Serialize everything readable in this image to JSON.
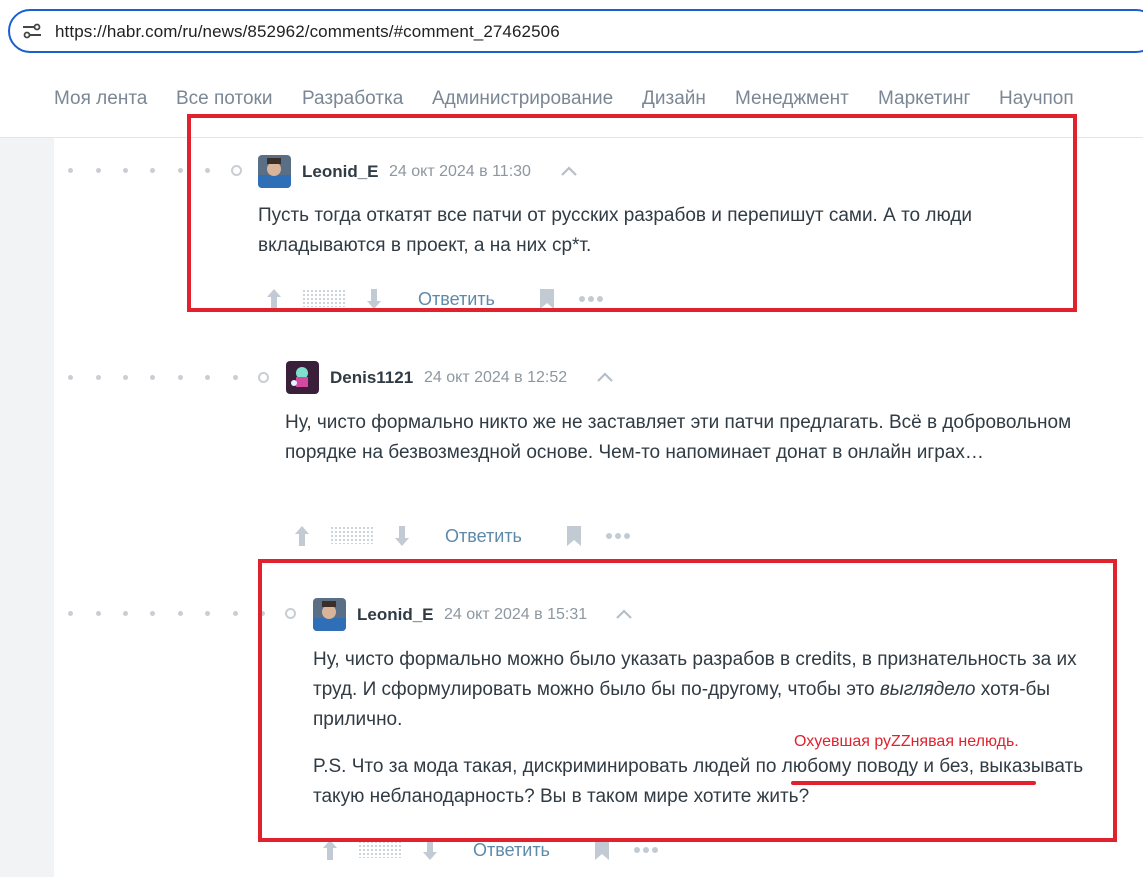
{
  "browser": {
    "url": "https://habr.com/ru/news/852962/comments/#comment_27462506"
  },
  "nav": {
    "items": [
      {
        "label": "Моя лента"
      },
      {
        "label": "Все потоки"
      },
      {
        "label": "Разработка"
      },
      {
        "label": "Администрирование"
      },
      {
        "label": "Дизайн"
      },
      {
        "label": "Менеджмент"
      },
      {
        "label": "Маркетинг"
      },
      {
        "label": "Научпоп"
      }
    ]
  },
  "comments": [
    {
      "username": "Leonid_E",
      "timestamp": "24 окт 2024 в 11:30",
      "text": "Пусть тогда откатят все патчи от русских разрабов и перепишут сами. А то люди вкладываются в проект, а на них ср*т.",
      "reply_label": "Ответить"
    },
    {
      "username": "Denis1121",
      "timestamp": "24 окт 2024 в 12:52",
      "text": "Ну, чисто формально никто же не заставляет эти патчи предлагать. Всё в добровольном порядке на безвозмездной основе. Чем-то напоминает донат в онлайн играх…",
      "reply_label": "Ответить"
    },
    {
      "username": "Leonid_E",
      "timestamp": "24 окт 2024 в 15:31",
      "text_p1_a": "Ну, чисто формально можно было указать разрабов в credits, в признательность за их труд. И сформулировать можно было бы по-другому, чтобы это ",
      "text_p1_em": "выглядело",
      "text_p1_b": " хотя-бы прилично.",
      "text_p2_a": "P.S. Что за мода такая, дискриминировать людей ",
      "text_p2_u": "по любому поводу и без,",
      "text_p2_b": " выказывать такую небланодарность? Вы в таком мире хотите жить?",
      "reply_label": "Ответить"
    }
  ],
  "annotation": {
    "text": "Охуевшая руZZнявая нелюдь.",
    "color": "#e0222e"
  },
  "colors": {
    "accent_link": "#5e8aaa",
    "url_border": "#1a5fd0",
    "highlight_red": "#e0222e"
  }
}
